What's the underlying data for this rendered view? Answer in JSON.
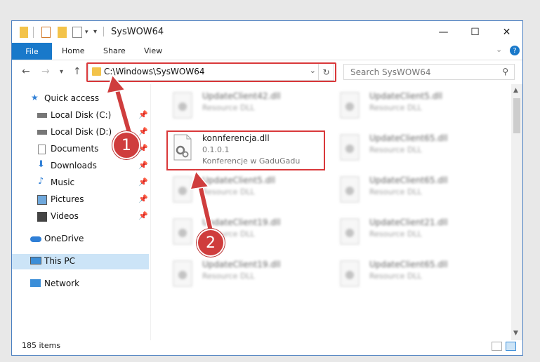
{
  "window": {
    "title": "SysWOW64"
  },
  "ribbon": {
    "tabs": [
      "File",
      "Home",
      "Share",
      "View"
    ]
  },
  "address": {
    "path": "C:\\Windows\\SysWOW64"
  },
  "search": {
    "placeholder": "Search SysWOW64"
  },
  "sidebar": {
    "items": [
      {
        "label": "Quick access",
        "icon": "star-icon"
      },
      {
        "label": "Local Disk (C:)",
        "icon": "drive-icon",
        "pinned": true
      },
      {
        "label": "Local Disk (D:)",
        "icon": "drive-icon",
        "pinned": true
      },
      {
        "label": "Documents",
        "icon": "documents-icon",
        "pinned": true
      },
      {
        "label": "Downloads",
        "icon": "download-icon",
        "pinned": true
      },
      {
        "label": "Music",
        "icon": "music-icon",
        "pinned": true
      },
      {
        "label": "Pictures",
        "icon": "pictures-icon",
        "pinned": true
      },
      {
        "label": "Videos",
        "icon": "videos-icon",
        "pinned": true
      },
      {
        "label": "OneDrive",
        "icon": "cloud-icon"
      },
      {
        "label": "This PC",
        "icon": "computer-icon",
        "selected": true
      },
      {
        "label": "Network",
        "icon": "network-icon"
      }
    ]
  },
  "files": {
    "highlighted": {
      "name": "konnferencja.dll",
      "version": "0.1.0.1",
      "description": "Konferencje w GaduGadu"
    },
    "left_column": [
      {
        "name": "UpdateClient42.dll",
        "type": "Resource DLL"
      },
      {
        "name": "UpdateClient5.dll",
        "type": "Resource DLL"
      },
      {
        "name": "UpdateClient19.dll",
        "type": "Resource DLL"
      },
      {
        "name": "UpdateClient19.dll",
        "type": "Resource DLL"
      }
    ],
    "right_column": [
      {
        "name": "UpdateClient5.dll",
        "type": "Resource DLL"
      },
      {
        "name": "UpdateClient65.dll",
        "type": "Resource DLL"
      },
      {
        "name": "UpdateClient65.dll",
        "type": "Resource DLL"
      },
      {
        "name": "UpdateClient21.dll",
        "type": "Resource DLL"
      },
      {
        "name": "UpdateClient65.dll",
        "type": "Resource DLL"
      }
    ]
  },
  "status": {
    "item_count": "185 items"
  },
  "annotations": {
    "callout1": "1",
    "callout2": "2"
  },
  "colors": {
    "accent": "#1979ca",
    "highlight_red": "#d9383a",
    "callout_red": "#cf3d3d",
    "selected_bg": "#cce4f7"
  }
}
